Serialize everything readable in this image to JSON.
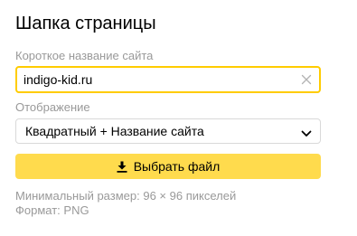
{
  "header": {
    "title": "Шапка страницы"
  },
  "site_name": {
    "label": "Короткое название сайта",
    "value": "indigo-kid.ru",
    "clear_icon": "close-icon"
  },
  "display": {
    "label": "Отображение",
    "selected": "Квадратный + Название сайта",
    "chevron_icon": "chevron-down-icon"
  },
  "upload": {
    "label": "Выбрать файл",
    "icon": "download-icon"
  },
  "hints": {
    "min_size": "Минимальный размер: 96 × 96 пикселей",
    "format": "Формат: PNG"
  },
  "colors": {
    "accent": "#ffcc00",
    "button": "#ffdb4d",
    "muted_text": "#999999",
    "border": "#d9d9d9"
  }
}
